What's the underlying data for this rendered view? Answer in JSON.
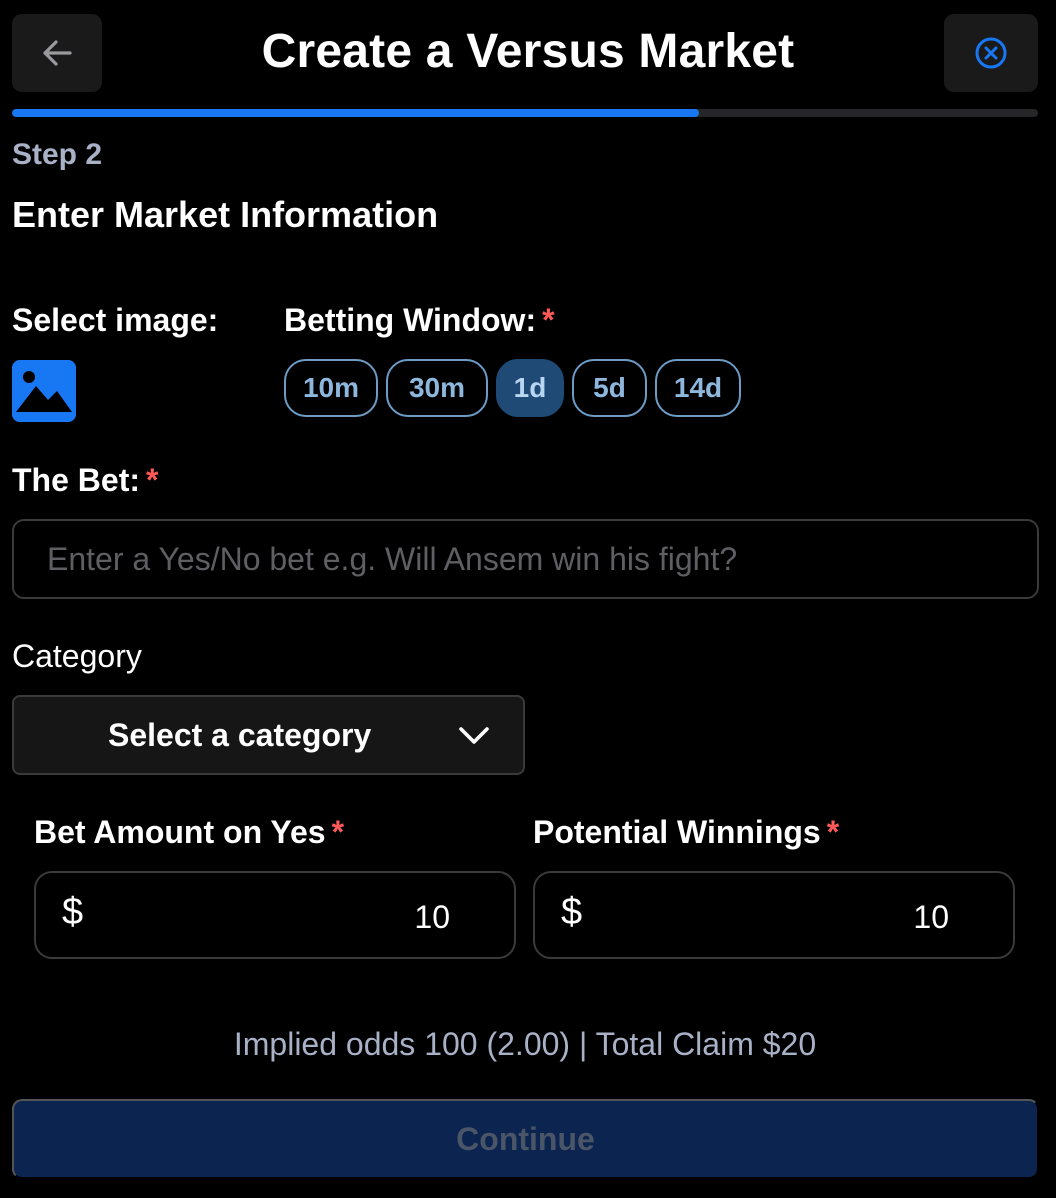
{
  "header": {
    "title": "Create a Versus Market",
    "back_icon": "arrow-left-icon",
    "close_icon": "circle-x-icon",
    "accent_color": "#1877f2"
  },
  "progress": {
    "fraction": 0.67
  },
  "step": {
    "label": "Step 2",
    "subtitle": "Enter Market Information"
  },
  "image": {
    "label": "Select image:",
    "icon": "image-icon"
  },
  "betting_window": {
    "label": "Betting Window:",
    "required_mark": "*",
    "options": [
      "10m",
      "30m",
      "1d",
      "5d",
      "14d"
    ],
    "selected": "1d"
  },
  "bet": {
    "label": "The Bet:",
    "required_mark": "*",
    "placeholder": "Enter a Yes/No bet e.g. Will Ansem win his fight?"
  },
  "category": {
    "label": "Category",
    "selected_text": "Select a category",
    "icon": "chevron-down-icon"
  },
  "bet_amount": {
    "label": "Bet Amount on Yes",
    "required_mark": "*",
    "currency": "$",
    "value": "10"
  },
  "winnings": {
    "label": "Potential Winnings",
    "required_mark": "*",
    "currency": "$",
    "value": "10"
  },
  "summary": {
    "text": "Implied odds 100 (2.00) | Total Claim $20"
  },
  "continue_label": "Continue"
}
